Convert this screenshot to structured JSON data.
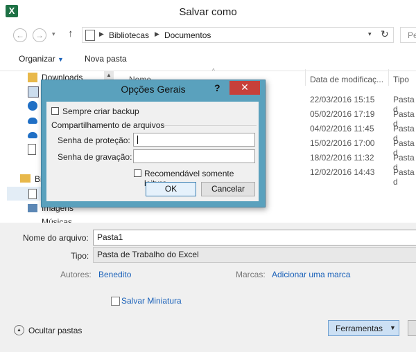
{
  "window": {
    "title": "Salvar como",
    "app_icon_letter": "X"
  },
  "address": {
    "folder_icon": "library-icon",
    "path": [
      "Bibliotecas",
      "Documentos"
    ],
    "search_placeholder": "Pe"
  },
  "toolbar": {
    "organize": "Organizar",
    "new_folder": "Nova pasta"
  },
  "nav_pane": {
    "items": [
      {
        "label": "Downloads",
        "icon": "downloads-folder-icon"
      },
      {
        "label": "",
        "icon": "computer-icon"
      },
      {
        "label": "",
        "icon": "homegroup-icon"
      },
      {
        "label": "",
        "icon": "onedrive-icon"
      },
      {
        "label": "",
        "icon": "onedrive-icon"
      },
      {
        "label": "",
        "icon": "document-icon"
      }
    ],
    "libraries_label": "Bi",
    "images_label": "Imagens",
    "music_label": "Músicas"
  },
  "file_list": {
    "columns": {
      "name": "Nome",
      "date": "Data de modificaç...",
      "type": "Tipo"
    },
    "rows": [
      {
        "date": "22/03/2016 15:15",
        "type": "Pasta d"
      },
      {
        "date": "05/02/2016 17:19",
        "type": "Pasta d"
      },
      {
        "date": "04/02/2016 11:45",
        "type": "Pasta d"
      },
      {
        "date": "15/02/2016 17:00",
        "type": "Pasta d"
      },
      {
        "date": "18/02/2016 11:32",
        "type": "Pasta d"
      },
      {
        "date": "12/02/2016 14:43",
        "type": "Pasta d"
      }
    ]
  },
  "form": {
    "filename_label": "Nome do arquivo:",
    "filename_value": "Pasta1",
    "type_label": "Tipo:",
    "type_value": "Pasta de Trabalho do Excel",
    "authors_label": "Autores:",
    "authors_value": "Benedito",
    "tags_label": "Marcas:",
    "tags_value": "Adicionar uma marca",
    "thumbnail_label": "Salvar Miniatura",
    "hide_folders": "Ocultar pastas",
    "tools": "Ferramentas"
  },
  "dialog": {
    "title": "Opções Gerais",
    "help": "?",
    "close": "✕",
    "backup_label": "Sempre criar backup",
    "sharing_group": "Compartilhamento de arquivos",
    "protect_label": "Senha de proteção:",
    "write_label": "Senha de gravação:",
    "readonly_label": "Recomendável somente leitura",
    "ok": "OK",
    "cancel": "Cancelar"
  }
}
